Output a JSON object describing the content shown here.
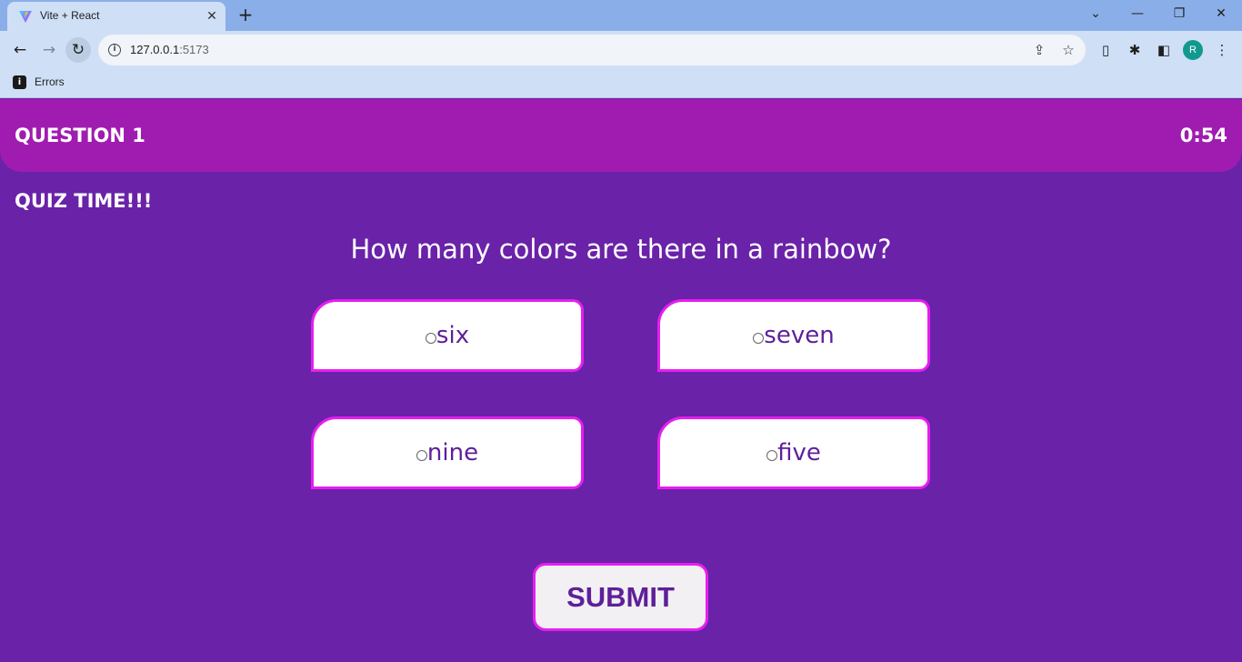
{
  "browser": {
    "tab_title": "Vite + React",
    "url_host": "127.0.0.1",
    "url_port": ":5173",
    "bookmark_label": "Errors",
    "profile_initial": "R"
  },
  "header": {
    "question_label": "QUESTION 1",
    "timer": "0:54"
  },
  "quiz_title": "QUIZ TIME!!!",
  "question_text": "How many colors are there in a rainbow?",
  "options": [
    {
      "label": "six"
    },
    {
      "label": "seven"
    },
    {
      "label": "nine"
    },
    {
      "label": "five"
    }
  ],
  "submit_label": "SUBMIT",
  "colors": {
    "page_bg": "#6a22a8",
    "header_bg": "#a01cb0",
    "option_border": "#e61ef0",
    "option_text": "#5e1f9a"
  }
}
